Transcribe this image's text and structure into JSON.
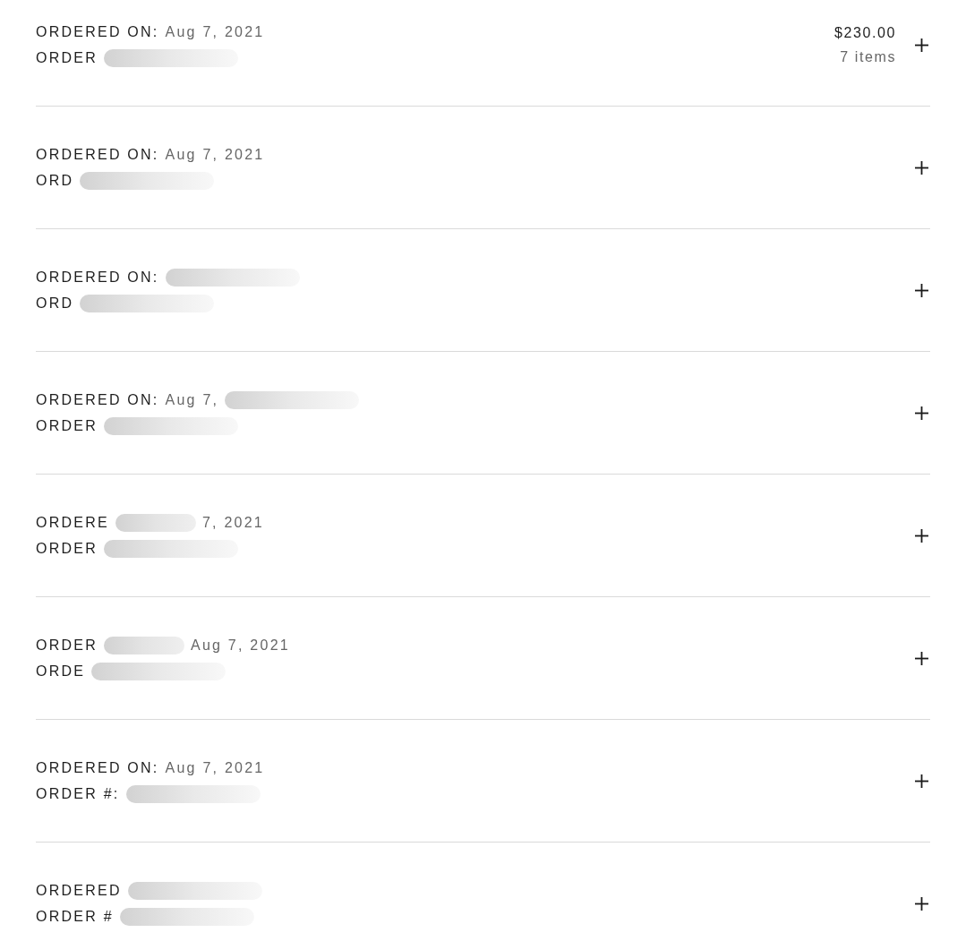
{
  "orders": [
    {
      "ordered_on": [
        {
          "kind": "label",
          "text": "ORDERED ON:"
        },
        {
          "kind": "value",
          "text": "Aug 7, 2021"
        }
      ],
      "order_number": [
        {
          "kind": "label",
          "text": "ORDER"
        },
        {
          "kind": "redacted"
        }
      ],
      "total": "$230.00",
      "item_count": "7 items",
      "expanded": false
    },
    {
      "ordered_on": [
        {
          "kind": "label",
          "text": "ORDERED ON:"
        },
        {
          "kind": "value",
          "text": "Aug 7, 2021"
        }
      ],
      "order_number": [
        {
          "kind": "label",
          "text": "ORD"
        },
        {
          "kind": "redacted"
        }
      ],
      "expanded": false
    },
    {
      "ordered_on": [
        {
          "kind": "label",
          "text": "ORDERED ON:"
        },
        {
          "kind": "redacted"
        }
      ],
      "order_number": [
        {
          "kind": "label",
          "text": "ORD"
        },
        {
          "kind": "redacted"
        }
      ],
      "expanded": false
    },
    {
      "ordered_on": [
        {
          "kind": "label",
          "text": "ORDERED ON:"
        },
        {
          "kind": "value",
          "text": "Aug 7,"
        },
        {
          "kind": "redacted"
        }
      ],
      "order_number": [
        {
          "kind": "label",
          "text": "ORDER"
        },
        {
          "kind": "redacted"
        }
      ],
      "expanded": false
    },
    {
      "ordered_on": [
        {
          "kind": "label",
          "text": "ORDERE"
        },
        {
          "kind": "redacted"
        },
        {
          "kind": "value",
          "text": "7, 2021"
        }
      ],
      "order_number": [
        {
          "kind": "label",
          "text": "ORDER"
        },
        {
          "kind": "redacted"
        }
      ],
      "expanded": false
    },
    {
      "ordered_on": [
        {
          "kind": "label",
          "text": "ORDER"
        },
        {
          "kind": "redacted"
        },
        {
          "kind": "value",
          "text": "Aug 7, 2021"
        }
      ],
      "order_number": [
        {
          "kind": "label",
          "text": "ORDE"
        },
        {
          "kind": "redacted"
        }
      ],
      "expanded": false
    },
    {
      "ordered_on": [
        {
          "kind": "label",
          "text": "ORDERED ON:"
        },
        {
          "kind": "value",
          "text": "Aug 7, 2021"
        }
      ],
      "order_number": [
        {
          "kind": "label",
          "text": "ORDER #:"
        },
        {
          "kind": "redacted"
        }
      ],
      "expanded": false
    },
    {
      "ordered_on": [
        {
          "kind": "label",
          "text": "ORDERED"
        },
        {
          "kind": "redacted"
        }
      ],
      "order_number": [
        {
          "kind": "label",
          "text": "ORDER #"
        },
        {
          "kind": "redacted"
        }
      ],
      "expanded": false
    }
  ]
}
